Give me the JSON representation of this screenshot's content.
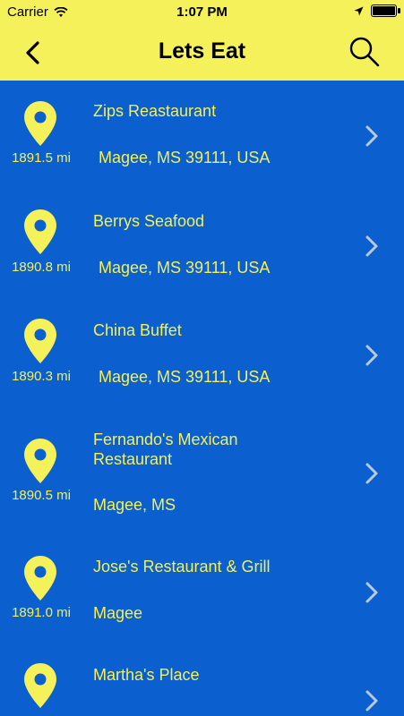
{
  "status": {
    "carrier": "Carrier",
    "time": "1:07 PM",
    "battery_level": 1.0
  },
  "nav": {
    "title": "Lets Eat"
  },
  "restaurants": [
    {
      "name": "Zips Reastaurant",
      "distance": "1891.5 mi",
      "address": "Magee, MS 39111, USA"
    },
    {
      "name": "Berrys Seafood",
      "distance": "1890.8 mi",
      "address": "Magee, MS 39111, USA"
    },
    {
      "name": "China Buffet",
      "distance": "1890.3 mi",
      "address": "Magee, MS 39111, USA"
    },
    {
      "name": "Fernando's Mexican Restaurant",
      "distance": "1890.5 mi",
      "address": "Magee, MS"
    },
    {
      "name": "Jose's Restaurant & Grill",
      "distance": "1891.0 mi",
      "address": "Magee"
    },
    {
      "name": "Martha's Place",
      "distance": "",
      "address": ""
    }
  ],
  "colors": {
    "bar": "#f4f15a",
    "background": "#0b5fcf",
    "text": "#f4f15a",
    "chevron": "#b9c9de"
  }
}
